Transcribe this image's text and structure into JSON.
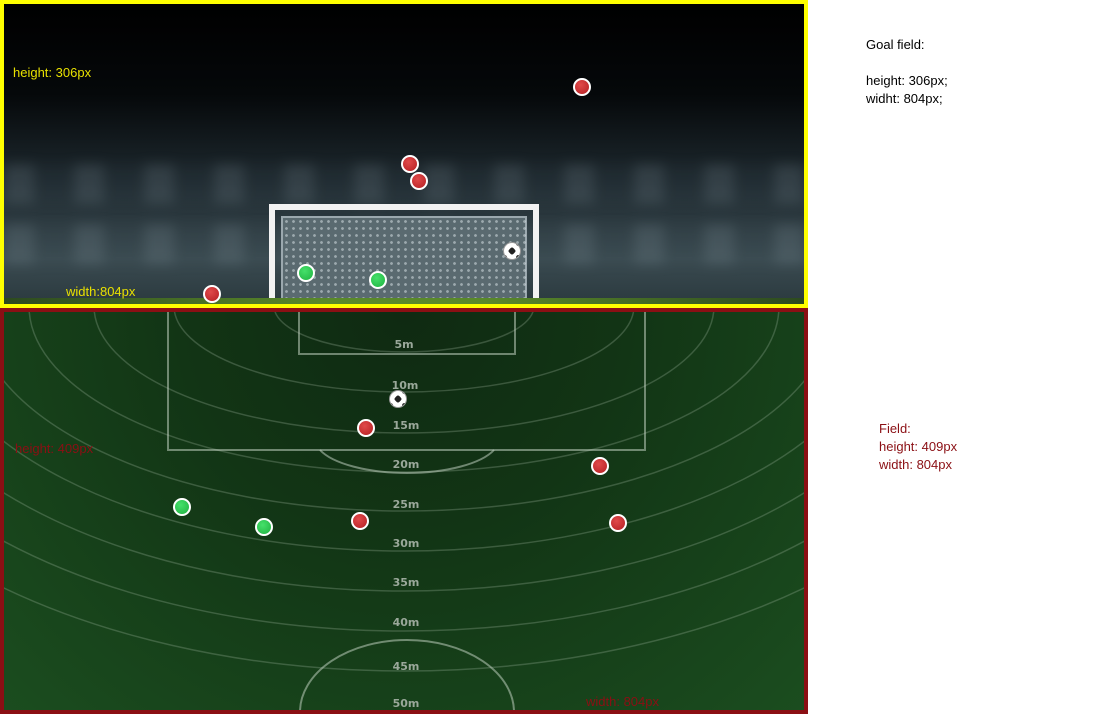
{
  "colors": {
    "goal_border": "#ffff00",
    "field_border": "#8b0f14",
    "goal_label": "#e8e000",
    "field_label": "#8b0f14",
    "player_red": "#b51f23",
    "player_green": "#1fb241"
  },
  "goal_panel": {
    "height_label": "height: 306px",
    "width_label": "width:804px"
  },
  "field_panel": {
    "height_label": "height: 409px",
    "width_label": "width: 804px",
    "distance_labels": [
      "5m",
      "10m",
      "15m",
      "20m",
      "25m",
      "30m",
      "35m",
      "40m",
      "45m",
      "50m"
    ]
  },
  "annotations": {
    "goal_title": "Goal field:",
    "goal_height": "height: 306px;",
    "goal_width": "widht: 804px;",
    "field_title": "Field:",
    "field_height": "height: 409px",
    "field_width": "width: 804px"
  },
  "icons": {
    "ball": "soccer-ball-icon",
    "red_player": "red-player-marker-icon",
    "green_player": "green-player-marker-icon"
  }
}
